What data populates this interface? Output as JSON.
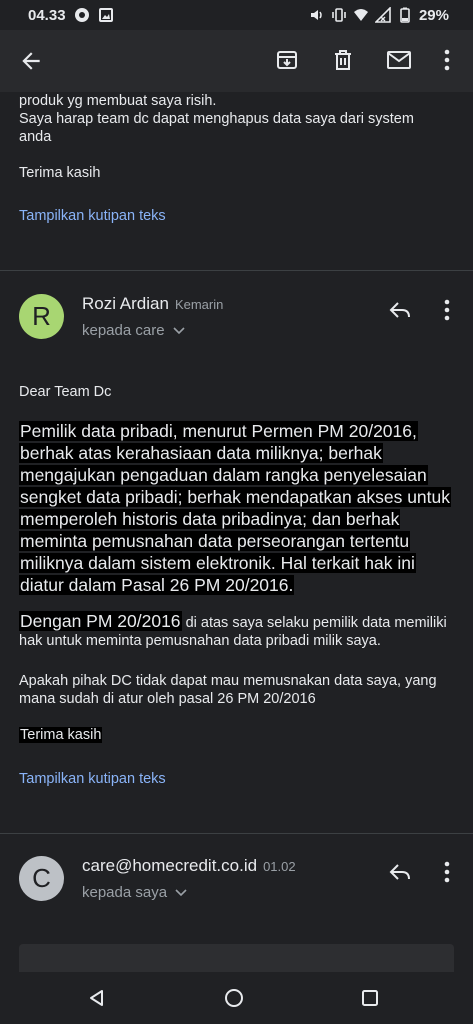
{
  "status_bar": {
    "time": "04.33",
    "battery": "29%"
  },
  "app_bar": {
    "back_icon": "arrow-left-icon",
    "actions": [
      "archive-icon",
      "delete-icon",
      "mail-icon",
      "more-vert-icon"
    ]
  },
  "quoted_previous": {
    "lines": [
      "produk yg membuat saya risih.",
      "Saya harap team dc dapat menghapus data saya dari system",
      "anda",
      "",
      "Terima kasih"
    ],
    "show_quote_label": "Tampilkan kutipan teks"
  },
  "message1": {
    "avatar_letter": "R",
    "avatar_color": "#a8d672",
    "sender": "Rozi Ardian",
    "time": "Kemarin",
    "recipient": "kepada care",
    "greeting": "Dear Team Dc",
    "highlight_paragraph": "Pemilik data pribadi, menurut Permen PM 20/2016, berhak atas kerahasiaan data miliknya; berhak mengajukan pengaduan dalam rangka penyelesaian sengket data pribadi; berhak mendapatkan akses untuk memperoleh historis data pribadinya; dan berhak meminta pemusnahan data perseorangan tertentu miliknya dalam sistem elektronik. Hal terkait hak ini diatur dalam Pasal 26 PM 20/2016.",
    "para2_highlight": "Dengan PM 20/2016",
    "para2_rest": " di atas saya selaku pemilik data memiliki hak untuk meminta pemusnahan data pribadi milik saya.",
    "para3": "Apakah pihak DC tidak dapat mau memusnakan data saya, yang mana sudah di atur oleh pasal 26 PM 20/2016",
    "closing": "Terima kasih",
    "show_quote_label": "Tampilkan kutipan teks"
  },
  "message2": {
    "avatar_letter": "C",
    "avatar_color": "#bdc1c6",
    "sender": "care@homecredit.co.id",
    "time": "01.02",
    "recipient": "kepada saya"
  },
  "nav_bar": {
    "buttons": [
      "back-triangle-icon",
      "home-circle-icon",
      "recents-square-icon"
    ]
  },
  "colors": {
    "background": "#202124",
    "link": "#8ab4f8",
    "secondary_text": "#9aa0a6"
  }
}
